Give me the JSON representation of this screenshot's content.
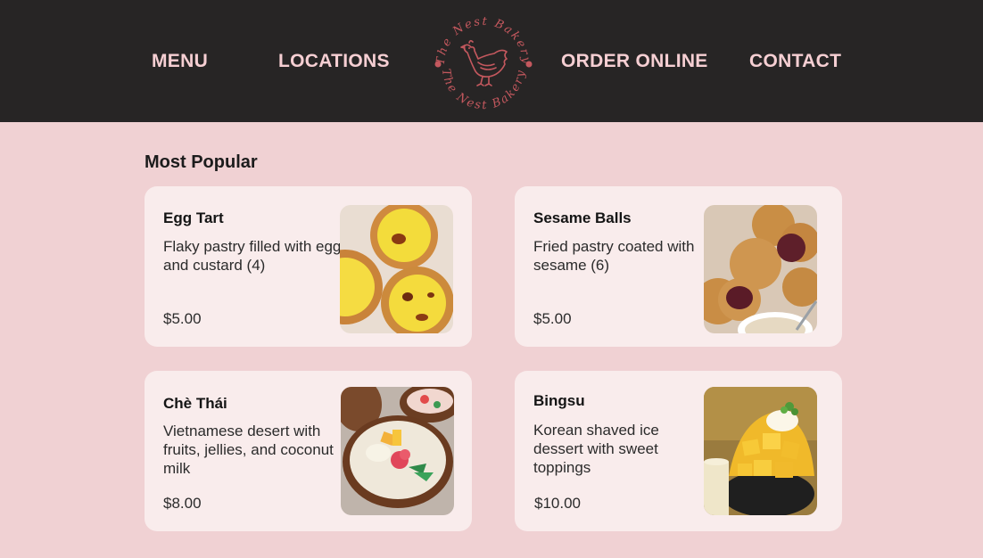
{
  "nav": {
    "menu": "MENU",
    "locations": "LOCATIONS",
    "order_online": "ORDER ONLINE",
    "contact": "CONTACT"
  },
  "logo": {
    "top_text": "The Nest Bakery",
    "bottom_text": "The Nest Bakery",
    "icon": "hen-icon",
    "color": "#c4585e"
  },
  "section": {
    "title": "Most Popular"
  },
  "items": [
    {
      "name": "Egg Tart",
      "description": "Flaky pastry filled with egg and custard (4)",
      "price": "$5.00",
      "image": "egg-tart-photo"
    },
    {
      "name": "Sesame Balls",
      "description": "Fried pastry coated with sesame (6)",
      "price": "$5.00",
      "image": "sesame-balls-photo"
    },
    {
      "name": "Chè Thái",
      "description": "Vietnamese desert with fruits, jellies, and coconut milk",
      "price": "$8.00",
      "image": "che-thai-photo"
    },
    {
      "name": "Bingsu",
      "description": "Korean shaved ice dessert with sweet toppings",
      "price": "$10.00",
      "image": "bingsu-photo"
    }
  ],
  "colors": {
    "header_bg": "#272525",
    "nav_text": "#f6cfd3",
    "page_bg": "#f0d1d3",
    "card_bg": "#f9ecec"
  }
}
